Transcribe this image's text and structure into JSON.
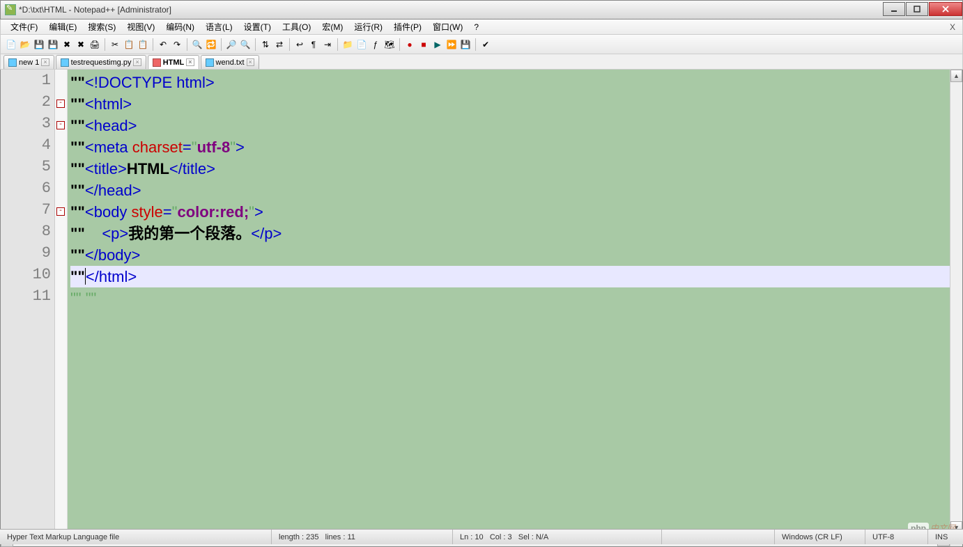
{
  "window": {
    "title": "*D:\\txt\\HTML - Notepad++ [Administrator]"
  },
  "menu": {
    "items": [
      "文件(F)",
      "编辑(E)",
      "搜索(S)",
      "视图(V)",
      "编码(N)",
      "语言(L)",
      "设置(T)",
      "工具(O)",
      "宏(M)",
      "运行(R)",
      "插件(P)",
      "窗口(W)",
      "?"
    ],
    "close_x": "X"
  },
  "toolbar_icons": [
    "new-file-icon",
    "open-icon",
    "save-icon",
    "save-all-icon",
    "close-icon",
    "close-all-icon",
    "print-icon",
    "|",
    "cut-icon",
    "copy-icon",
    "paste-icon",
    "|",
    "undo-icon",
    "redo-icon",
    "|",
    "find-icon",
    "replace-icon",
    "|",
    "zoom-in-icon",
    "zoom-out-icon",
    "|",
    "sync-v-icon",
    "sync-h-icon",
    "|",
    "wrap-icon",
    "all-chars-icon",
    "indent-icon",
    "|",
    "folder-icon",
    "doc-icon",
    "function-icon",
    "doc-map-icon",
    "|",
    "record-icon",
    "stop-icon",
    "play-icon",
    "play-multi-icon",
    "save-macro-icon",
    "|",
    "spellcheck-icon"
  ],
  "tabs": [
    {
      "label": "new 1",
      "active": false,
      "saved": true
    },
    {
      "label": "testrequestimg.py",
      "active": false,
      "saved": true
    },
    {
      "label": "HTML",
      "active": true,
      "saved": false
    },
    {
      "label": "wend.txt",
      "active": false,
      "saved": true
    }
  ],
  "code": {
    "lines": [
      {
        "n": 1,
        "segs": [
          {
            "t": "\"\"",
            "c": "q"
          },
          {
            "t": "<!DOCTYPE html>",
            "c": "tag"
          }
        ]
      },
      {
        "n": 2,
        "fold": "-",
        "segs": [
          {
            "t": "\"\"",
            "c": "q"
          },
          {
            "t": "<html>",
            "c": "tag"
          }
        ]
      },
      {
        "n": 3,
        "fold": "-",
        "segs": [
          {
            "t": "\"\"",
            "c": "q"
          },
          {
            "t": "<head>",
            "c": "tag"
          }
        ]
      },
      {
        "n": 4,
        "segs": [
          {
            "t": "\"\"",
            "c": "q"
          },
          {
            "t": "<meta ",
            "c": "tag"
          },
          {
            "t": "charset",
            "c": "attr"
          },
          {
            "t": "=",
            "c": "tag"
          },
          {
            "t": "\"",
            "c": "opq"
          },
          {
            "t": "utf-8",
            "c": "val"
          },
          {
            "t": "\"",
            "c": "opq"
          },
          {
            "t": ">",
            "c": "tag"
          }
        ]
      },
      {
        "n": 5,
        "segs": [
          {
            "t": "\"\"",
            "c": "q"
          },
          {
            "t": "<title>",
            "c": "tag"
          },
          {
            "t": "HTML",
            "c": "txt"
          },
          {
            "t": "</title>",
            "c": "tag"
          }
        ]
      },
      {
        "n": 6,
        "segs": [
          {
            "t": "\"\"",
            "c": "q"
          },
          {
            "t": "</head>",
            "c": "tag"
          }
        ]
      },
      {
        "n": 7,
        "fold": "-",
        "segs": [
          {
            "t": "\"\"",
            "c": "q"
          },
          {
            "t": "<body ",
            "c": "tag"
          },
          {
            "t": "style",
            "c": "attr"
          },
          {
            "t": "=",
            "c": "tag"
          },
          {
            "t": "\"",
            "c": "opq"
          },
          {
            "t": "color:red;",
            "c": "val"
          },
          {
            "t": "\"",
            "c": "opq"
          },
          {
            "t": ">",
            "c": "tag"
          }
        ]
      },
      {
        "n": 8,
        "segs": [
          {
            "t": "\"\"",
            "c": "q"
          },
          {
            "t": "    ",
            "c": ""
          },
          {
            "t": "<p>",
            "c": "tag"
          },
          {
            "t": "我的第一个段落。",
            "c": "txt"
          },
          {
            "t": "</p>",
            "c": "tag"
          }
        ]
      },
      {
        "n": 9,
        "segs": [
          {
            "t": "\"\"",
            "c": "q"
          },
          {
            "t": "</body>",
            "c": "tag"
          }
        ]
      },
      {
        "n": 10,
        "current": true,
        "segs": [
          {
            "t": "\"\"",
            "c": "q"
          },
          {
            "t": "</html>",
            "c": "tag"
          }
        ],
        "caret_after": 0
      },
      {
        "n": 11,
        "segs": [
          {
            "t": "\"\" \"\"",
            "c": "opq"
          }
        ]
      }
    ]
  },
  "status": {
    "filetype": "Hyper Text Markup Language file",
    "length": "length : 235",
    "lines": "lines : 11",
    "ln": "Ln : 10",
    "col": "Col : 3",
    "sel": "Sel : N/A",
    "eol": "Windows (CR LF)",
    "enc": "UTF-8",
    "ins": "INS"
  },
  "watermark": {
    "logo": "php",
    "text": "中文网"
  }
}
